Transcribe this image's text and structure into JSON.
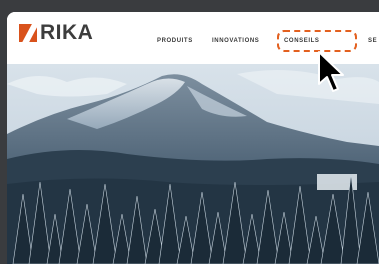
{
  "brand": {
    "name": "RIKA",
    "accent": "#d9521c"
  },
  "nav": {
    "items": [
      {
        "label": "PRODUITS"
      },
      {
        "label": "INNOVATIONS"
      },
      {
        "label": "CONSEILS"
      },
      {
        "label": "SE"
      }
    ],
    "highlighted": "CONSEILS"
  },
  "hero": {
    "image": "snowy-mountain-forest"
  },
  "cursor": {
    "type": "arrow-pointer"
  },
  "colors": {
    "highlight": "#e3601f",
    "background": "#3a3c3f"
  }
}
